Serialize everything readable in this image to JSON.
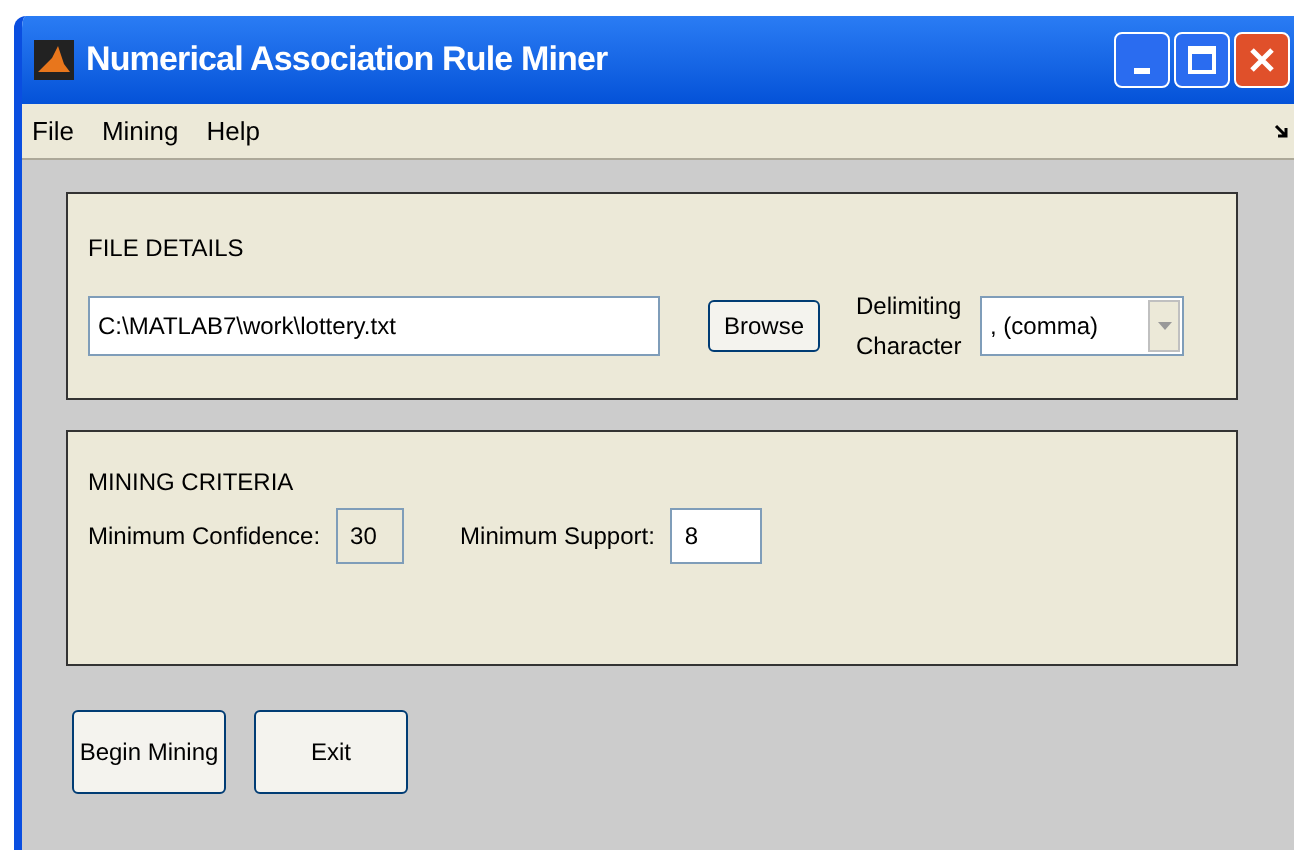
{
  "window": {
    "title": "Numerical Association Rule Miner"
  },
  "menu": [
    "File",
    "Mining",
    "Help"
  ],
  "file_details": {
    "title": "FILE DETAILS",
    "path": "C:\\MATLAB7\\work\\lottery.txt",
    "browse": "Browse",
    "delimiter_label": "Delimiting Character",
    "delimiter": ", (comma)"
  },
  "mining_criteria": {
    "title": "MINING CRITERIA",
    "fields": [
      {
        "label": "Minimum Confidence:",
        "value": "30",
        "disabled": true
      },
      {
        "label": "Minimum Support:",
        "value": "8",
        "disabled": false
      }
    ]
  },
  "buttons": [
    "Begin Mining",
    "Exit"
  ]
}
